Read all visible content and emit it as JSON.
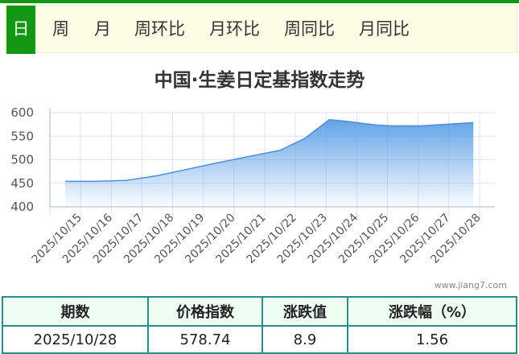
{
  "tabs": [
    {
      "label": "日",
      "active": true
    },
    {
      "label": "周"
    },
    {
      "label": "月"
    },
    {
      "label": "周环比"
    },
    {
      "label": "月环比"
    },
    {
      "label": "周同比"
    },
    {
      "label": "月同比"
    }
  ],
  "watermark": "www.jiang7.com",
  "colors": {
    "accent_green": "#139713",
    "area_fill_top": "#5b9ee6",
    "area_line": "#4f8fd8",
    "table_border": "#2e8b8b",
    "table_header_bg": "#eefef3"
  },
  "chart_data": {
    "type": "area",
    "title": "中国·生姜日定基指数走势",
    "x": [
      "2025/10/15",
      "2025/10/16",
      "2025/10/17",
      "2025/10/18",
      "2025/10/19",
      "2025/10/20",
      "2025/10/21",
      "2025/10/22",
      "2025/10/23",
      "2025/10/24",
      "2025/10/25",
      "2025/10/26",
      "2025/10/27",
      "2025/10/28"
    ],
    "values": [
      454,
      454,
      456,
      466,
      480,
      494,
      507,
      520,
      545,
      585,
      582,
      574,
      572,
      572,
      578.74
    ],
    "x_values": [
      0,
      1,
      2,
      3,
      4,
      5,
      6,
      7,
      7.8,
      8.6,
      9.1,
      10.1,
      10.6,
      11.6,
      13.3
    ],
    "yticks": [
      400,
      450,
      500,
      550,
      600
    ],
    "ylim": [
      400,
      600
    ],
    "grid": true,
    "legend": "none"
  },
  "table": {
    "headers": [
      "期数",
      "价格指数",
      "涨跌值",
      "涨跌幅（%）"
    ],
    "row": [
      "2025/10/28",
      "578.74",
      "8.9",
      "1.56"
    ]
  }
}
